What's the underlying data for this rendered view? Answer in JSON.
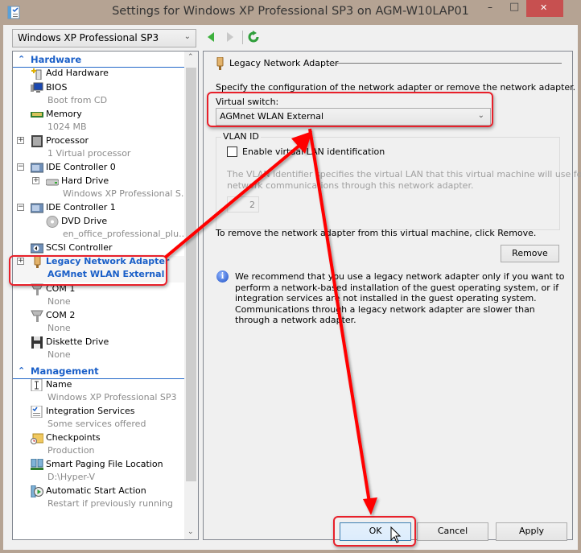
{
  "window": {
    "title": "Settings for Windows XP Professional SP3 on AGM-W10LAP01",
    "minimize_glyph": "–",
    "maximize_glyph": "□",
    "close_glyph": "✕"
  },
  "toolbar": {
    "vm_selected": "Windows XP Professional SP3",
    "back_icon": "◀",
    "forward_icon": "▶",
    "refresh_icon": "↻"
  },
  "tree": {
    "hardware_header": "Hardware",
    "management_header": "Management",
    "hardware_items": [
      {
        "label": "Add Hardware",
        "sub": ""
      },
      {
        "label": "BIOS",
        "sub": "Boot from CD"
      },
      {
        "label": "Memory",
        "sub": "1024 MB"
      },
      {
        "label": "Processor",
        "sub": "1 Virtual processor"
      },
      {
        "label": "IDE Controller 0",
        "sub": ""
      },
      {
        "label": "Hard Drive",
        "sub": "Windows XP Professional S..."
      },
      {
        "label": "IDE Controller 1",
        "sub": ""
      },
      {
        "label": "DVD Drive",
        "sub": "en_office_professional_plu..."
      },
      {
        "label": "SCSI Controller",
        "sub": ""
      },
      {
        "label": "Legacy Network Adapter",
        "sub": "AGMnet WLAN External"
      },
      {
        "label": "COM 1",
        "sub": "None"
      },
      {
        "label": "COM 2",
        "sub": "None"
      },
      {
        "label": "Diskette Drive",
        "sub": "None"
      }
    ],
    "management_items": [
      {
        "label": "Name",
        "sub": "Windows XP Professional SP3"
      },
      {
        "label": "Integration Services",
        "sub": "Some services offered"
      },
      {
        "label": "Checkpoints",
        "sub": "Production"
      },
      {
        "label": "Smart Paging File Location",
        "sub": "D:\\Hyper-V"
      },
      {
        "label": "Automatic Start Action",
        "sub": "Restart if previously running"
      }
    ]
  },
  "pane": {
    "header": "Legacy Network Adapter",
    "description": "Specify the configuration of the network adapter or remove the network adapter.",
    "virtual_switch_label": "Virtual switch:",
    "virtual_switch_value": "AGMnet WLAN External",
    "vlan_legend": "VLAN ID",
    "vlan_checkbox_label": "Enable virtual LAN identification",
    "vlan_checked": false,
    "vlan_help_line1": "The VLAN identifier specifies the virtual LAN that this virtual machine will use for all",
    "vlan_help_line2": "network communications through this network adapter.",
    "vlan_id_value": "2",
    "remove_text": "To remove the network adapter from this virtual machine, click Remove.",
    "remove_button": "Remove",
    "info_text": "We recommend that you use a legacy network adapter only if you want to perform a network-based installation of the guest operating system, or if integration services are not installed in the guest operating system. Communications through a legacy network adapter are slower than through a network adapter."
  },
  "buttons": {
    "ok": "OK",
    "cancel": "Cancel",
    "apply": "Apply"
  },
  "annotation_color": "#e8202a",
  "accent_color": "#1a5fc8"
}
